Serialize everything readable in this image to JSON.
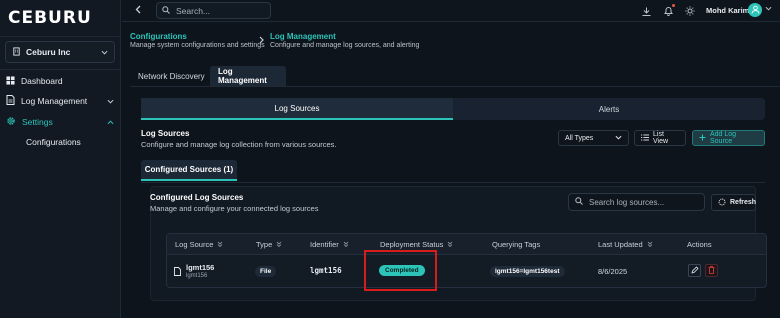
{
  "brand": {
    "logo_text": "CEBURU"
  },
  "org_selector": {
    "value": "Ceburu Inc"
  },
  "sidebar": {
    "items": [
      {
        "label": "Dashboard",
        "icon": "dashboard-icon"
      },
      {
        "label": "Log Management",
        "icon": "document-icon"
      },
      {
        "label": "Settings",
        "icon": "gear-icon"
      }
    ],
    "sub_items": [
      {
        "label": "Configurations"
      }
    ]
  },
  "topbar": {
    "search_placeholder": "Search...",
    "user_name": "Mohd Karim"
  },
  "breadcrumb": [
    {
      "title": "Configurations",
      "subtitle": "Manage system configurations and settings"
    },
    {
      "title": "Log Management",
      "subtitle": "Configure and manage log sources, and alerting"
    }
  ],
  "main_tabs": [
    {
      "label": "Network Discovery",
      "active": false
    },
    {
      "label": "Log Management",
      "active": true
    }
  ],
  "segment_tabs": [
    {
      "label": "Log Sources",
      "active": true
    },
    {
      "label": "Alerts",
      "active": false
    }
  ],
  "log_sources_header": {
    "title": "Log Sources",
    "description": "Configure and manage log collection from various sources.",
    "type_filter": "All Types",
    "list_view_label": "List View",
    "add_button_label": "Add Log Source"
  },
  "sub_tab": {
    "label": "Configured Sources (1)"
  },
  "configured_section": {
    "title": "Configured Log Sources",
    "description": "Manage and configure your connected log sources",
    "search_placeholder": "Search log sources...",
    "refresh_label": "Refresh"
  },
  "table": {
    "columns": [
      "Log Source",
      "Type",
      "Identifier",
      "Deployment Status",
      "Querying Tags",
      "Last Updated",
      "Actions"
    ],
    "rows": [
      {
        "name": "lgmt156",
        "name_sub": "lgmt156",
        "type": "File",
        "identifier": "lgmt156",
        "status": "Completed",
        "tag": "lgmt156=lgmt156test",
        "last_updated": "8/6/2025"
      }
    ]
  },
  "colors": {
    "accent": "#2cc4b8",
    "background": "#0e141c",
    "highlight_box": "#d81c1c",
    "delete": "#e0443e"
  }
}
